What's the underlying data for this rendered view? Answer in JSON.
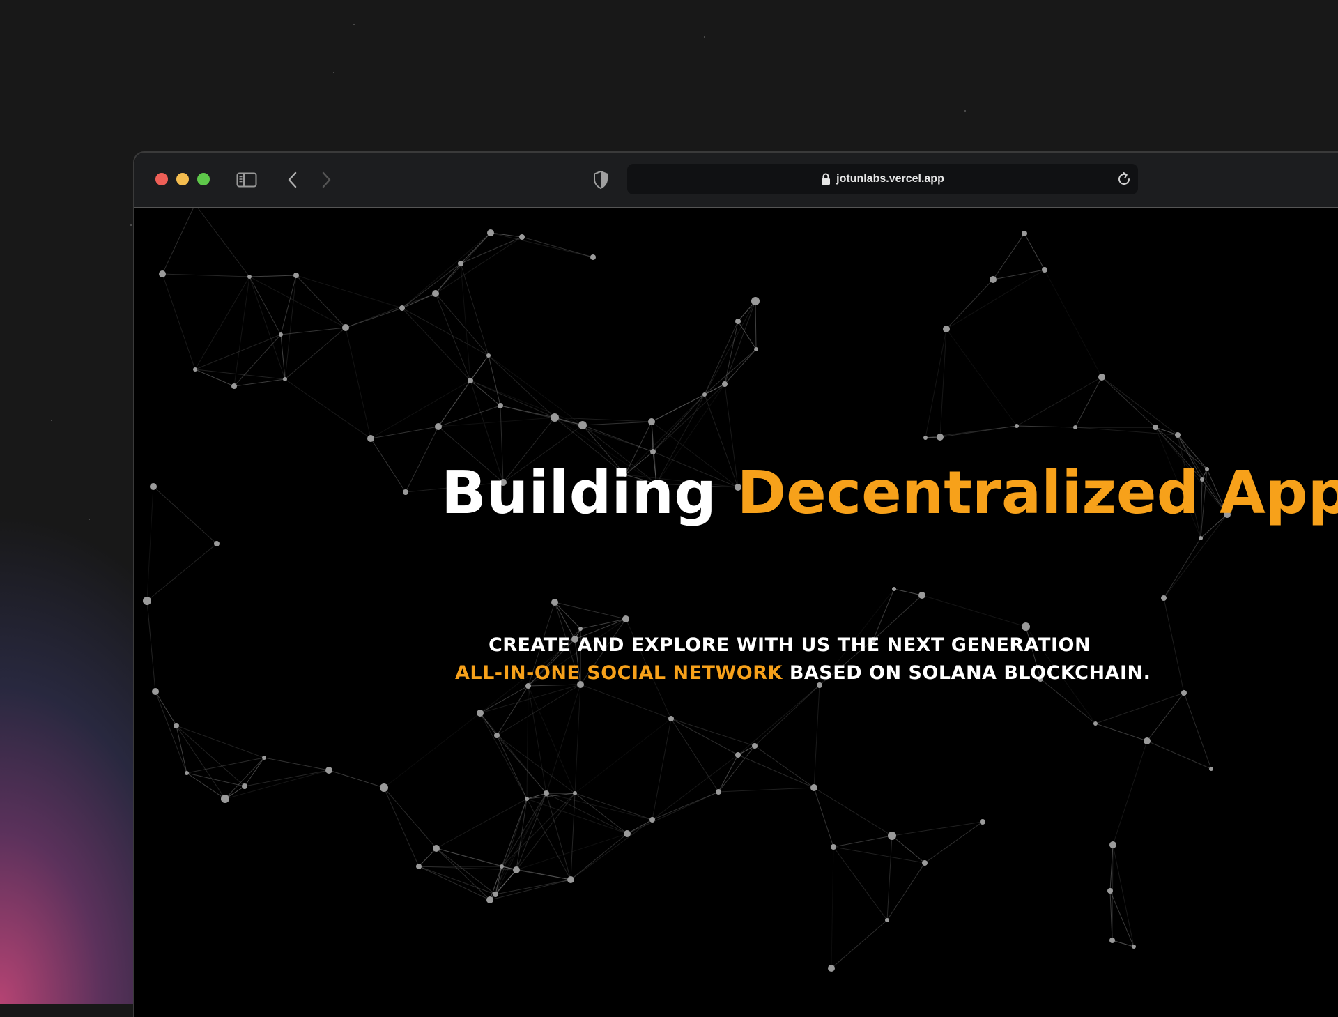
{
  "browser": {
    "url": "jotunlabs.vercel.app"
  },
  "hero": {
    "title_plain": "Building",
    "title_accent": "Decentralized Apps",
    "subtitle_line1": "CREATE AND EXPLORE WITH US THE NEXT GENERATION",
    "subtitle_accent": "ALL-IN-ONE SOCIAL NETWORK",
    "subtitle_rest": "BASED ON SOLANA BLOCKCHAIN."
  },
  "colors": {
    "accent": "#f7a11a",
    "page_background": "#000000",
    "toolbar": "#1c1d1f",
    "particles": "#9a9a9a"
  },
  "icons": {
    "window_controls": [
      "close-icon",
      "minimize-icon",
      "zoom-icon"
    ],
    "toolbar": [
      "sidebar-icon",
      "back-chevron-icon",
      "forward-chevron-icon",
      "shield-icon",
      "lock-icon",
      "reload-icon"
    ]
  }
}
